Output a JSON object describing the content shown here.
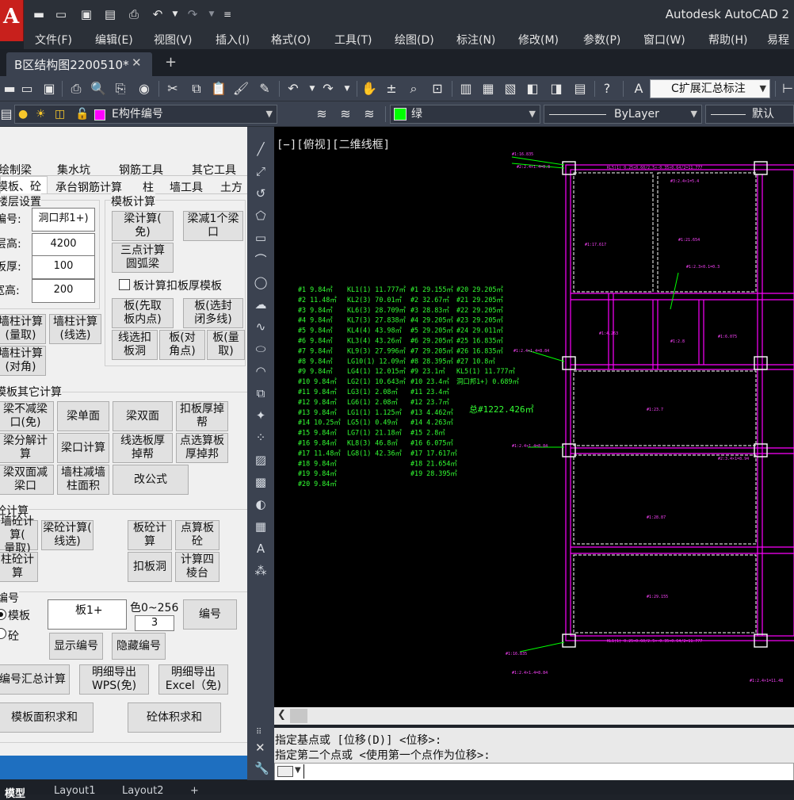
{
  "app": {
    "logo_letter": "A",
    "title": "Autodesk AutoCAD 2"
  },
  "quick_access": [
    "new-icon",
    "open-icon",
    "save-icon",
    "saveas-icon",
    "plot-icon",
    "undo-icon",
    "redo-icon",
    "customize-icon"
  ],
  "menus": [
    "文件(F)",
    "编辑(E)",
    "视图(V)",
    "插入(I)",
    "格式(O)",
    "工具(T)",
    "绘图(D)",
    "标注(N)",
    "修改(M)",
    "参数(P)",
    "窗口(W)",
    "帮助(H)",
    "易程"
  ],
  "document_tab": {
    "label": "B区结构图2200510*",
    "close": "✕",
    "new_tab": "+"
  },
  "toolbar1": {
    "dim_style": "C扩展汇总标注"
  },
  "toolbar2": {
    "layer": "E构件编号",
    "layer_color": "#ff00ff",
    "color_name": "绿",
    "color_swatch": "#00ff00",
    "linetype": "ByLayer",
    "lineweight": "默认"
  },
  "palette": {
    "tabs_row1": [
      "绘制梁",
      "集水坑",
      "钢筋工具",
      "其它工具"
    ],
    "tabs_row2": [
      "模板、砼",
      "承台钢筋计算",
      "柱",
      "墙工具",
      "土方"
    ],
    "floor_section": "楼层设置",
    "fields": [
      {
        "label": "编号:",
        "value": "洞口邦1+)"
      },
      {
        "label": "层高:",
        "value": "4200"
      },
      {
        "label": "板厚:",
        "value": "100"
      },
      {
        "label": "梁宽高:",
        "value": "200"
      }
    ],
    "formwork_section": "模板计算",
    "fw_buttons": [
      "梁计算(\n免)",
      "梁减1个梁\n口",
      "三点计算\n圆弧梁",
      "板(先取\n板内点)",
      "板(选封\n闭多线)",
      "线选扣\n板洞",
      "板(对\n角点)",
      "板(量\n取)"
    ],
    "checkbox_label": "板计算扣板厚模板",
    "wall_buttons": [
      "墙柱计算\n(量取)",
      "墙柱计算\n(线选)",
      "墙柱计算\n(对角)"
    ],
    "other_section": "模板其它计算",
    "other_buttons": [
      "梁不减梁\n口(免)",
      "梁单面",
      "梁双面",
      "扣板厚掉\n帮",
      "梁分解计\n算",
      "梁口计算",
      "线选板厚\n掉帮",
      "点选算板\n厚掉邦",
      "梁双面减\n梁口",
      "墙柱减墙\n柱面积",
      "改公式"
    ],
    "concrete_section": "砼计算",
    "concrete_buttons": [
      "墙砼计算(\n量取)",
      "梁砼计算(\n线选)",
      "板砼计\n算",
      "点算板\n砼",
      "柱砼计\n算",
      "扣板洞",
      "计算四\n棱台"
    ],
    "number_section": "编号",
    "radio_formwork": "模板",
    "radio_concrete": "砼",
    "number_value": "板1+",
    "color_range_label": "色0~256",
    "color_value": "3",
    "number_button": "编号",
    "show_number": "显示编号",
    "hide_number": "隐藏编号",
    "summary_button": "编号汇总计算",
    "export_wps": "明细导出\nWPS(免)",
    "export_excel": "明细导出\nExcel（免)",
    "sum_formwork": "模板面积求和",
    "sum_concrete": "砼体积求和"
  },
  "viewport": {
    "label": "[−][俯视][二维线框]"
  },
  "cad_table": {
    "col1": [
      "#1 9.84㎡",
      "#2 11.48㎡",
      "#3 9.84㎡",
      "#4 9.84㎡",
      "#5 9.84㎡",
      "#6 9.84㎡",
      "#7 9.84㎡",
      "#8 9.84㎡",
      "#9 9.84㎡",
      "#10 9.84㎡",
      "#11 9.84㎡",
      "#12 9.84㎡",
      "#13 9.84㎡",
      "#14 10.25㎡",
      "#15 9.84㎡",
      "#16 9.84㎡",
      "#17 11.48㎡",
      "#18 9.84㎡",
      "#19 9.84㎡",
      "#20 9.84㎡"
    ],
    "col2": [
      "KL1(1) 11.777㎡",
      "KL2(3) 70.01㎡",
      "KL6(3) 28.709㎡",
      "KL7(3) 27.838㎡",
      "KL4(4) 43.98㎡",
      "KL3(4) 43.26㎡",
      "KL9(3) 27.996㎡",
      "LG10(1) 12.09㎡",
      "LG4(1) 12.015㎡",
      "LG2(1) 10.643㎡",
      "LG3(1) 2.08㎡",
      "LG6(1) 2.08㎡",
      "LG1(1) 1.125㎡",
      "LG5(1) 0.49㎡",
      "LG7(1) 21.18㎡",
      "KL8(3) 46.8㎡",
      "LG8(1) 42.36㎡"
    ],
    "col3": [
      "#1 29.155㎡",
      "#2 32.67㎡",
      "#3 28.83㎡",
      "#4 29.205㎡",
      "#5 29.205㎡",
      "#6 29.205㎡",
      "#7 29.205㎡",
      "#8 28.395㎡",
      "#9 23.1㎡",
      "#10 23.4㎡",
      "#11 23.4㎡",
      "#12 23.7㎡",
      "#13 4.462㎡",
      "#14 4.263㎡",
      "#15 2.8㎡",
      "#16 6.075㎡",
      "#17 17.617㎡",
      "#18 21.654㎡",
      "#19 28.395㎡"
    ],
    "col4": [
      "#20 29.205㎡",
      "#21 29.205㎡",
      "#22 29.205㎡",
      "#23 29.205㎡",
      "#24 29.011㎡",
      "#25 16.835㎡",
      "#26 16.835㎡",
      "#27 10.8㎡",
      "KL5(1) 11.777㎡",
      "洞口邦1+) 0.689㎡"
    ],
    "total": "总#1222.426㎡"
  },
  "command": {
    "line1": "指定基点或 [位移(D)] <位移>:",
    "line2": "指定第二个点或 <使用第一个点作为位移>:"
  },
  "layout_tabs": [
    "模型",
    "Layout1",
    "Layout2",
    "+"
  ]
}
